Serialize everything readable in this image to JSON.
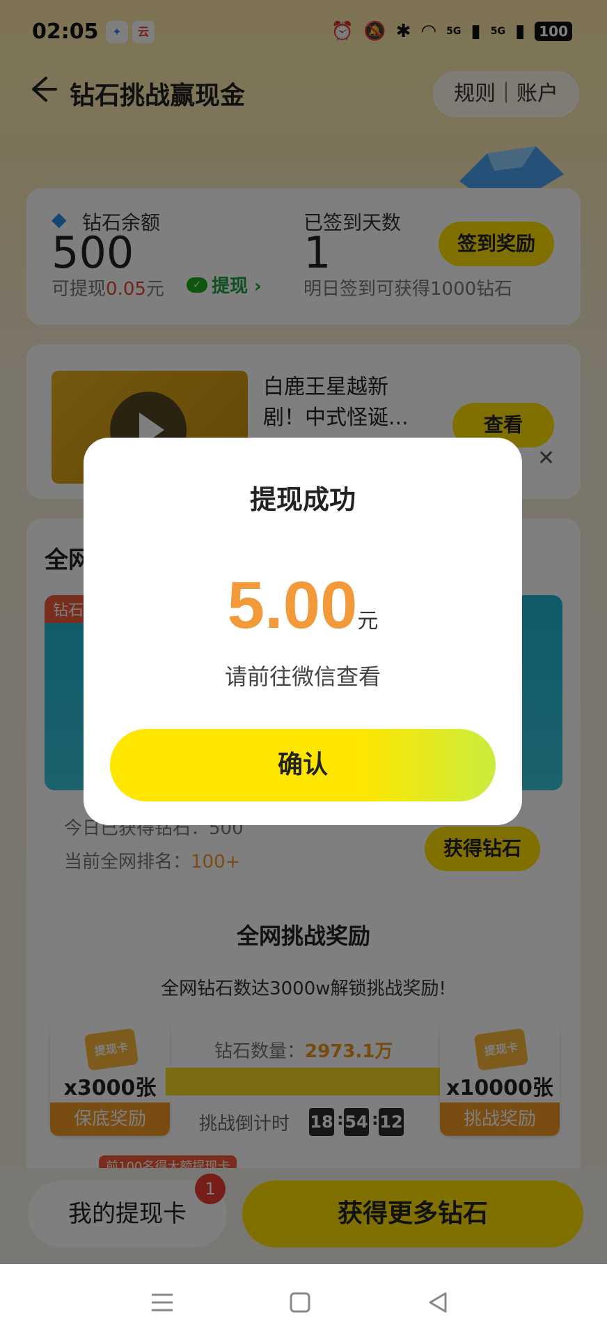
{
  "status_bar": {
    "time": "02:05",
    "network_1": "5G",
    "network_2": "5G",
    "battery": "100"
  },
  "header": {
    "title": "钻石挑战赢现金",
    "rules_account": "规则｜账户"
  },
  "balance": {
    "diamond_label": "钻石余额",
    "diamond_value": "500",
    "withdrawable_prefix": "可提现",
    "withdrawable_amount": "0.05",
    "withdrawable_unit": "元",
    "withdraw_link": "提现 ›",
    "checkin_label": "已签到天数",
    "checkin_days": "1",
    "checkin_tip": "明日签到可获得1000钻石",
    "checkin_button": "签到奖励"
  },
  "video": {
    "title": "白鹿王星越新剧！中式怪诞...",
    "view_button": "查看",
    "close": "✕"
  },
  "challenge": {
    "title": "全网",
    "banner_tag": "钻石",
    "today_diamonds": "今日已获得钻石：500",
    "rank_label": "当前全网排名：",
    "rank_value": "100+",
    "get_diamonds_button": "获得钻石",
    "reward_title": "全网挑战奖励",
    "reward_sub": "全网钻石数达3000w解锁挑战奖励!",
    "diamond_count_label": "钻石数量：",
    "diamond_count_value": "2973.1万",
    "progress": 0.991,
    "countdown_label": "挑战倒计时",
    "countdown_h": "18",
    "countdown_m": "54",
    "countdown_s": "12",
    "left_prize_card": "提现卡",
    "left_prize_count": "x3000张",
    "left_prize_label": "保底奖励",
    "right_prize_card": "提现卡",
    "right_prize_count": "x10000张",
    "right_prize_label": "挑战奖励",
    "top100_tag": "前100名得大额提现卡"
  },
  "bottom": {
    "my_card": "我的提现卡",
    "badge": "1",
    "more_diamonds": "获得更多钻石"
  },
  "dialog": {
    "title": "提现成功",
    "amount": "5.00",
    "unit": "元",
    "note": "请前往微信查看",
    "confirm": "确认"
  },
  "colors": {
    "accent_yellow": "#ffe100",
    "amount_orange": "#f2993a",
    "badge_red": "#ef3c37"
  }
}
